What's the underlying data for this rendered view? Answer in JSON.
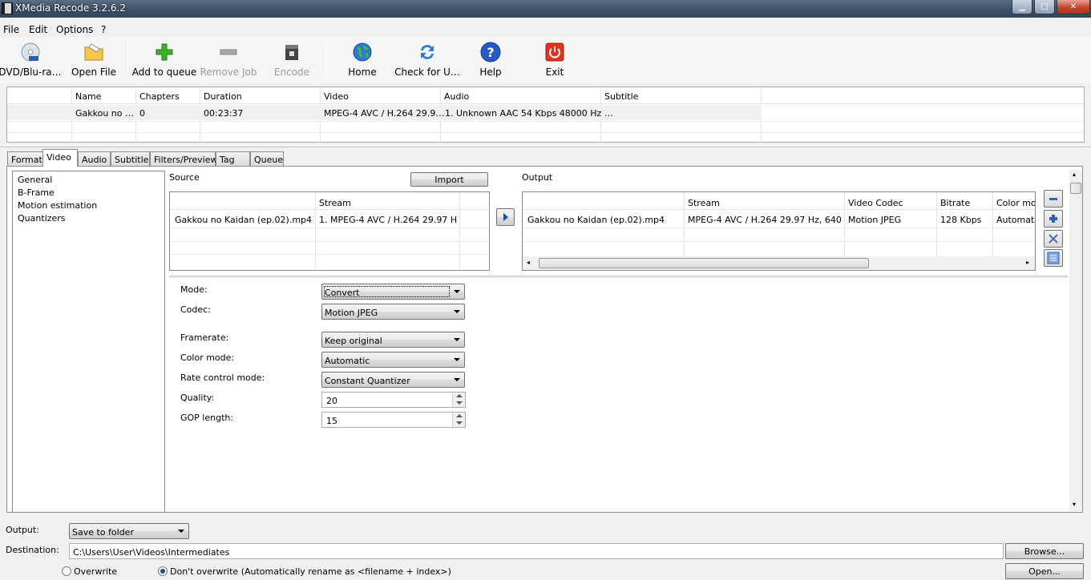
{
  "window": {
    "title": "XMedia Recode 3.2.6.2"
  },
  "menu": [
    "File",
    "Edit",
    "Options",
    "?"
  ],
  "toolbar": {
    "dvd": "DVD/Blu-ra…",
    "open_file": "Open File",
    "add_queue": "Add to queue",
    "remove_job": "Remove Job",
    "encode": "Encode",
    "home": "Home",
    "check_updates": "Check for U…",
    "help": "Help",
    "exit": "Exit"
  },
  "joblist": {
    "headers": [
      "Name",
      "Chapters",
      "Duration",
      "Video",
      "Audio",
      "Subtitle"
    ],
    "row": [
      "Gakkou no …",
      "0",
      "00:23:37",
      "MPEG-4 AVC / H.264 29.9…",
      "1. Unknown AAC  54 Kbps 48000 Hz …",
      ""
    ]
  },
  "tabs": [
    "Format",
    "Video",
    "Audio",
    "Subtitle",
    "Filters/Preview",
    "Tag",
    "Queue"
  ],
  "tree": [
    "General",
    "B-Frame",
    "Motion estimation",
    "Quantizers"
  ],
  "source": {
    "label": "Source",
    "import_label": "Import",
    "stream_header": "Stream",
    "file": "Gakkou no Kaidan (ep.02).mp4",
    "stream": "1. MPEG-4 AVC / H.264 29.97 H…"
  },
  "output": {
    "label": "Output",
    "headers": [
      "Stream",
      "Video Codec",
      "Bitrate",
      "Color moc"
    ],
    "file": "Gakkou no Kaidan (ep.02).mp4",
    "row": [
      "MPEG-4 AVC / H.264 29.97 Hz, 640 …",
      "Motion JPEG",
      "128 Kbps",
      "Automatic"
    ]
  },
  "form": {
    "mode_label": "Mode:",
    "mode_value": "Convert",
    "codec_label": "Codec:",
    "codec_value": "Motion JPEG",
    "framerate_label": "Framerate:",
    "framerate_value": "Keep original",
    "color_label": "Color mode:",
    "color_value": "Automatic",
    "rate_label": "Rate control mode:",
    "rate_value": "Constant Quantizer",
    "quality_label": "Quality:",
    "quality_value": "20",
    "gop_label": "GOP length:",
    "gop_value": "15"
  },
  "bottom": {
    "output_label": "Output:",
    "output_value": "Save to folder",
    "dest_label": "Destination:",
    "dest_value": "C:\\Users\\User\\Videos\\Intermediates",
    "browse": "Browse...",
    "overwrite": "Overwrite",
    "dont_overwrite": "Don't overwrite (Automatically rename as <filename + index>)",
    "open": "Open..."
  },
  "colors": {
    "titlebar": "#3c4f66",
    "close": "#c3432d",
    "accent_blue": "#1a4f9e"
  }
}
